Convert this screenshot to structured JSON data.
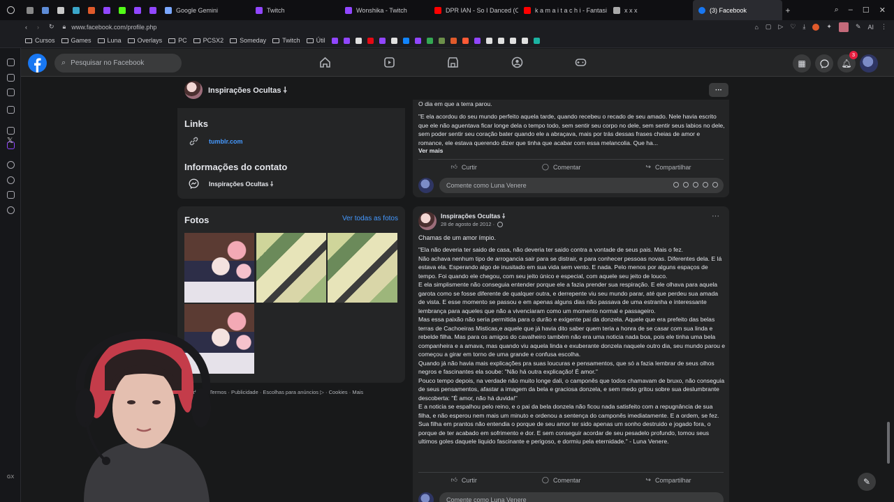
{
  "browser": {
    "tabs": [
      {
        "label": "",
        "color": "#888888"
      },
      {
        "label": "",
        "color": "#5d8bd6"
      },
      {
        "label": "",
        "color": "#c8c8c8"
      },
      {
        "label": "",
        "color": "#3aa6c9"
      },
      {
        "label": "",
        "color": "#e05a2b"
      },
      {
        "label": "",
        "color": "#9146ff"
      },
      {
        "label": "",
        "color": "#53fc18"
      },
      {
        "label": "",
        "color": "#9146ff"
      },
      {
        "label": "",
        "color": "#9146ff"
      },
      {
        "label": "Google Gemini",
        "color": "#7aa7ff"
      },
      {
        "label": "Twitch",
        "color": "#9146ff"
      },
      {
        "label": "Wonshika - Twitch",
        "color": "#9146ff"
      },
      {
        "label": "DPR IAN - So I Danced (O",
        "color": "#ff0000"
      },
      {
        "label": "k a m a i t a c h i - Fantasi",
        "color": "#ff0000"
      },
      {
        "label": "x x x",
        "color": "#aaaaaa"
      },
      {
        "label": "(3) Facebook",
        "color": "#1877f2"
      }
    ],
    "url": "www.facebook.com/profile.php",
    "bookmarks": [
      {
        "label": "Cursos",
        "type": "folder"
      },
      {
        "label": "Games",
        "type": "folder"
      },
      {
        "label": "Luna",
        "type": "folder"
      },
      {
        "label": "Overlays",
        "type": "folder"
      },
      {
        "label": "PC",
        "type": "folder"
      },
      {
        "label": "PCSX2",
        "type": "folder"
      },
      {
        "label": "Someday",
        "type": "folder"
      },
      {
        "label": "Twitch",
        "type": "folder"
      },
      {
        "label": "Útil",
        "type": "folder"
      }
    ],
    "bookmark_icon_colors": [
      "#9146ff",
      "#9146ff",
      "#e0e0e0",
      "#e50914",
      "#9146ff",
      "#e0e0e0",
      "#1185fe",
      "#9146ff",
      "#34a853",
      "#6c8f4a",
      "#e05a2b",
      "#ff5a36",
      "#9146ff",
      "#e0e0e0",
      "#e0e0e0",
      "#e0e0e0",
      "#e0e0e0",
      "#1bb3a2"
    ]
  },
  "facebook": {
    "search_placeholder": "Pesquisar no Facebook",
    "notification_count": "3",
    "page_name": "Inspirações Ocultas ⸸",
    "links": {
      "title": "Links",
      "url": "tumblr.com"
    },
    "contact": {
      "title": "Informações do contato",
      "messenger": "Inspirações Ocultas ⸸"
    },
    "photos": {
      "title": "Fotos",
      "see_all": "Ver todas as fotos"
    },
    "footer": "Privacidade · Termos · Publicidade · Escolhas para anúncios ▷ · Cookies · Mais",
    "post1": {
      "heading": "O dia em que a terra parou.",
      "text": "\"E ela acordou do seu mundo perfeito aquela tarde, quando recebeu o recado de seu amado. Nele havia escrito que ele não aguentava ficar longe dela o tempo todo, sem sentir seu corpo no dele, sem sentir seus labios no dele, sem poder sentir seu coração bater quando ele a abraçava, mais por trás dessas frases cheias de amor e romance, ele estava querendo dizer que tinha que acabar com essa melancolia. Que ha...",
      "see_more": "Ver mais"
    },
    "actions": {
      "like": "Curtir",
      "comment": "Comentar",
      "share": "Compartilhar"
    },
    "comment_placeholder": "Comente como Luna Venere",
    "post2": {
      "author": "Inspirações Ocultas ⸸",
      "date": "28 de agosto de 2012 ·",
      "title": "Chamas de um amor ímpio.",
      "paragraphs": [
        "\"Ela não deveria ter saido de casa, não deveria ter saido contra a vontade de seus pais. Mais o fez.",
        "Não achava nenhum tipo de arrogancia sair para se distrair, e para conhecer pessoas novas. Diferentes dela. E lá estava ela. Esperando algo de inusitado em sua vida sem vento. E nada. Pelo menos por alguns espaços de tempo. Foi quando ele chegou, com seu jeito único e especial, com aquele seu jeito de louco.",
        "E ela simplismente não conseguia entender porque ele a fazia prender sua respiração. E ele olhava para aquela garota como se fosse diferente de qualquer outra, e derrepente viu seu mundo parar, até que perdeu sua amada de vista. E esse momento se passou e em apenas alguns dias não passava de uma estranha e interessante lembrança para aqueles que não a vivenciaram como um momento normal e passageiro.",
        "Mas essa paixão não seria permitida para o durão e exigente pai da donzela. Aquele que era prefeito das belas terras de Cachoeiras Misticas,e aquele que já havia dito saber quem teria a honra de se casar com sua linda e rebelde filha. Mas para os amigos do cavalheiro também não era uma noticia nada boa, pois ele tinha uma bela companheira e a amava, mas quando viu aquela linda e exuberante donzela naquele outro dia, seu mundo parou e começou a girar em torno de uma grande e confusa escolha.",
        "Quando já não havia mais explicações pra suas loucuras e pensamentos, que só a fazia lembrar de seus olhos negros e fascinantes ela soube: \"Não há outra explicação! É amor.\"",
        "Pouco tempo depois, na verdade não muito longe dali, o camponês que todos chamavam de bruxo, não conseguia de seus pensamentos, afastar a imagem da bela e graciosa donzela, e sem medo gritou sobre sua deslumbrante descoberta: \"É amor, não há duvida!\"",
        "E a noticia se espalhou pelo reino, e o pai da bela donzela não ficou nada satisfeito com a repugnância de sua filha, e não esperou nem mais um minuto e ordenou a sentença do camponês imediatamente. E a ordem, se fez.",
        "Sua filha em prantos não entendia o porque de seu amor ter sido apenas um sonho destruido e jogado fora, o porque de ter acabado em sofrimento e dor. E sem conseguir acordar de seu pesadelo profundo, tomou seus ultimos goles daquele liquido fascinante e perigoso, e dormiu pela eternidade.\"  - Luna Venere."
      ]
    }
  },
  "stream": {
    "gx_label": "GX"
  }
}
